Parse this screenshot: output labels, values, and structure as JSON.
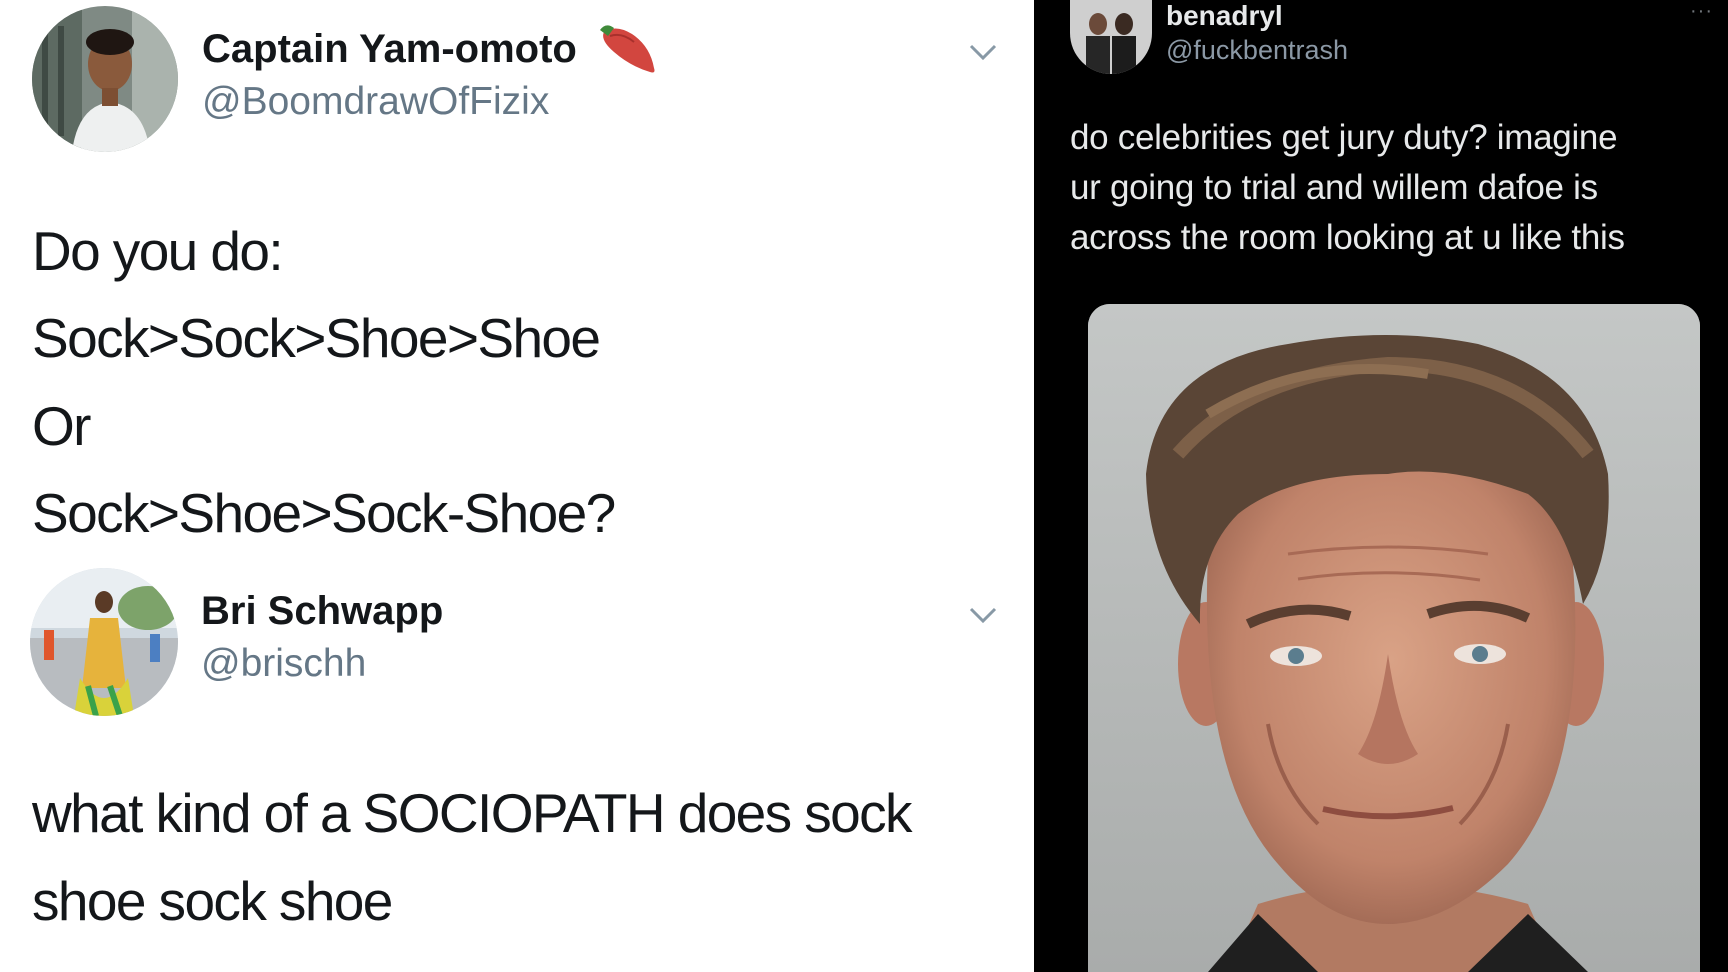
{
  "tweet1": {
    "display_name": "Captain Yam-omoto",
    "name_emoji": "sweet-potato-emoji",
    "handle": "@BoomdrawOfFizix",
    "lines": [
      "Do you do:",
      "Sock>Sock>Shoe>Shoe",
      "Or",
      "Sock>Shoe>Sock-Shoe?"
    ]
  },
  "tweet2": {
    "display_name": "Bri Schwapp",
    "handle": "@brischh",
    "lines": [
      "what kind of a SOCIOPATH does sock",
      "shoe sock shoe"
    ]
  },
  "tweet3": {
    "display_name": "benadryl",
    "handle": "@fuckbentrash",
    "more": "···",
    "lines": [
      "do celebrities get jury duty? imagine",
      "ur going to trial and willem dafoe is",
      "across the room looking at u like this"
    ]
  },
  "colors": {
    "light_bg": "#ffffff",
    "dark_bg": "#000000",
    "handle_gray": "#657786",
    "text_dark": "#14171a",
    "text_light": "#e7e9ea"
  }
}
